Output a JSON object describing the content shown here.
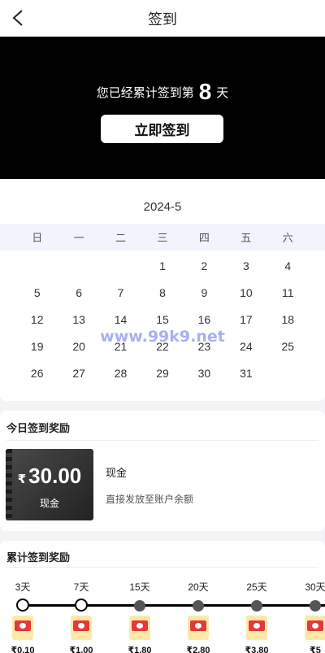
{
  "header": {
    "title": "签到",
    "back_icon": "chevron-left-icon"
  },
  "banner": {
    "prefix": "您已经累计签到第",
    "days": "8",
    "suffix": "天",
    "button_label": "立即签到"
  },
  "calendar": {
    "month": "2024-5",
    "weekdays": [
      "日",
      "一",
      "二",
      "三",
      "四",
      "五",
      "六"
    ],
    "days": [
      "",
      "",
      "",
      "1",
      "2",
      "3",
      "4",
      "5",
      "6",
      "7",
      "8",
      "9",
      "10",
      "11",
      "12",
      "13",
      "14",
      "15",
      "16",
      "17",
      "18",
      "19",
      "20",
      "21",
      "22",
      "23",
      "24",
      "25",
      "26",
      "27",
      "28",
      "29",
      "30",
      "31"
    ],
    "watermark": "www.99k9.net"
  },
  "today": {
    "title": "今日签到奖励",
    "currency": "₹",
    "amount": "30.00",
    "type": "现金",
    "name": "现金",
    "description": "直接发放至账户余额"
  },
  "cumulative": {
    "title": "累计签到奖励",
    "milestones": [
      {
        "label": "3天",
        "amount": "₹0.10",
        "state": "open"
      },
      {
        "label": "7天",
        "amount": "₹1.00",
        "state": "open"
      },
      {
        "label": "15天",
        "amount": "₹1.80",
        "state": "closed"
      },
      {
        "label": "20天",
        "amount": "₹2.80",
        "state": "closed"
      },
      {
        "label": "25天",
        "amount": "₹3.80",
        "state": "closed"
      },
      {
        "label": "30天",
        "amount": "₹5",
        "state": "closed"
      }
    ]
  }
}
